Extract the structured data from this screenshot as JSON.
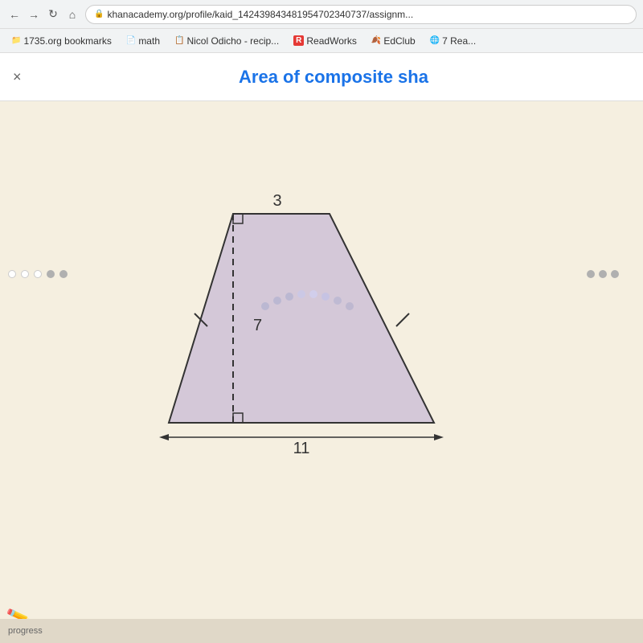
{
  "browser": {
    "back_arrow": "←",
    "forward_arrow": "→",
    "reload_icon": "↻",
    "home_icon": "⌂",
    "url": "khanacademy.org/profile/kaid_142439843481954702340737/assignm...",
    "lock_icon": "🔒"
  },
  "bookmarks": [
    {
      "id": "bookmark-1",
      "label": "1735.org bookmarks",
      "icon": "📁"
    },
    {
      "id": "bookmark-math",
      "label": "math",
      "icon": "📄"
    },
    {
      "id": "bookmark-nicol",
      "label": "Nicol Odicho - recip...",
      "icon": "📋"
    },
    {
      "id": "bookmark-readworks",
      "label": "ReadWorks",
      "icon": "R"
    },
    {
      "id": "bookmark-edclub",
      "label": "EdClub",
      "icon": "🍂"
    },
    {
      "id": "bookmark-7rea",
      "label": "7 Rea...",
      "icon": "🌐"
    }
  ],
  "page": {
    "close_label": "×",
    "title": "Area of composite sha",
    "diagram": {
      "top_label": "3",
      "height_label": "7",
      "bottom_label": "11",
      "right_angle_symbol": "⊾"
    }
  },
  "bottom": {
    "pencil": "✏️",
    "progress_text": "progress"
  }
}
